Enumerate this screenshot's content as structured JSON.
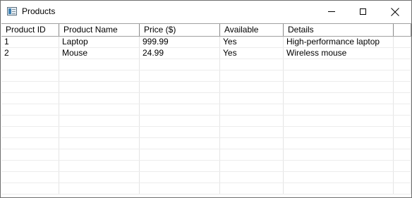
{
  "window": {
    "title": "Products",
    "controls": [
      "minimize",
      "maximize",
      "close"
    ]
  },
  "table": {
    "columns": [
      "Product ID",
      "Product Name",
      "Price ($)",
      "Available",
      "Details",
      ""
    ],
    "rows": [
      [
        "1",
        "Laptop",
        "999.99",
        "Yes",
        "High-performance laptop",
        ""
      ],
      [
        "2",
        "Mouse",
        "24.99",
        "Yes",
        "Wireless mouse",
        ""
      ]
    ],
    "visible_row_count": 14
  },
  "icons": {
    "app": "window-app-icon",
    "minimize": "minimize-icon",
    "maximize": "maximize-icon",
    "close": "close-icon"
  },
  "colors": {
    "background": "#ffffff",
    "header_border": "#a0a0a0",
    "grid_line": "#ececec"
  }
}
